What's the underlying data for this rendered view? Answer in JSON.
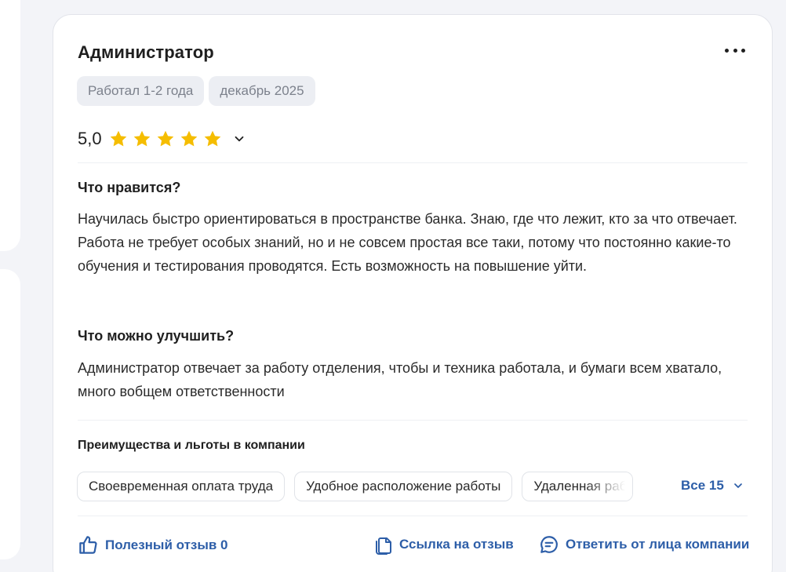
{
  "review": {
    "title": "Администратор",
    "chips": [
      "Работал 1-2 года",
      "декабрь 2025"
    ],
    "rating": {
      "value_text": "5,0",
      "value": 5,
      "max": 5
    },
    "likes_heading": "Что нравится?",
    "likes_text": "Научилась быстро ориентироваться в пространстве банка. Знаю, где что лежит, кто за что отвечает. Работа не требует особых знаний, но и не совсем простая все таки, потому что постоянно какие-то обучения и тестирования проводятся. Есть возможность на повышение уйти.",
    "improve_heading": "Что можно улучшить?",
    "improve_text": "Администратор отвечает за работу отделения, чтобы и техника работала, и бумаги всем хватало, много вобщем ответственности"
  },
  "benefits": {
    "heading": "Преимущества и льготы в компании",
    "items": [
      "Своевременная оплата труда",
      "Удобное расположение работы",
      "Удаленная работа"
    ],
    "all_label": "Все 15"
  },
  "footer": {
    "helpful_label": "Полезный отзыв 0",
    "link_label": "Ссылка на отзыв",
    "reply_label": "Ответить от лица компании"
  },
  "colors": {
    "accent": "#2d5ea8",
    "star": "#f5bd00",
    "chip_bg": "#eceef3"
  },
  "icons": {
    "more": "more-dots-icon",
    "star": "star-icon",
    "chevron": "chevron-down-icon",
    "helpful": "thumbs-up-icon",
    "link": "copy-link-icon",
    "reply": "chat-bubble-icon"
  }
}
